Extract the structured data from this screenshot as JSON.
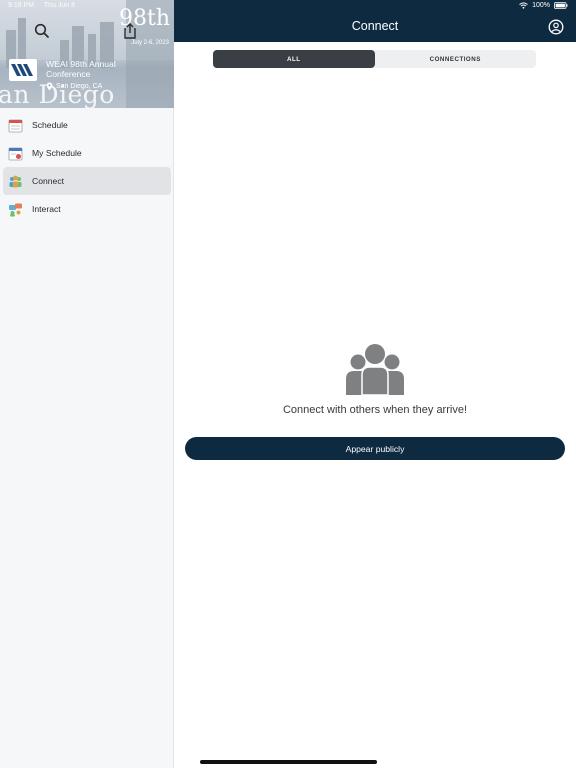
{
  "status": {
    "time": "9:16 PM",
    "date": "Thu Jun 8",
    "battery": "100%"
  },
  "sidebar": {
    "banner": {
      "big_text": "an Diego",
      "badge_num": "98th",
      "badge_sub": "July 2-6, 2023"
    },
    "event": {
      "title": "WEAI 98th Annual Conference",
      "location": "San Diego, CA"
    },
    "items": [
      {
        "label": "Schedule",
        "icon": "calendar-icon"
      },
      {
        "label": "My Schedule",
        "icon": "my-schedule-icon"
      },
      {
        "label": "Connect",
        "icon": "people-icon",
        "active": true
      },
      {
        "label": "Interact",
        "icon": "interact-icon"
      }
    ]
  },
  "header": {
    "title": "Connect"
  },
  "tabs": [
    {
      "label": "ALL",
      "active": true
    },
    {
      "label": "CONNECTIONS",
      "active": false
    }
  ],
  "empty_state": {
    "message": "Connect with others when they arrive!",
    "button_label": "Appear publicly"
  },
  "colors": {
    "navy": "#0e2a41",
    "segment_active": "#3a3f45",
    "icon_gray": "#7f8082"
  }
}
